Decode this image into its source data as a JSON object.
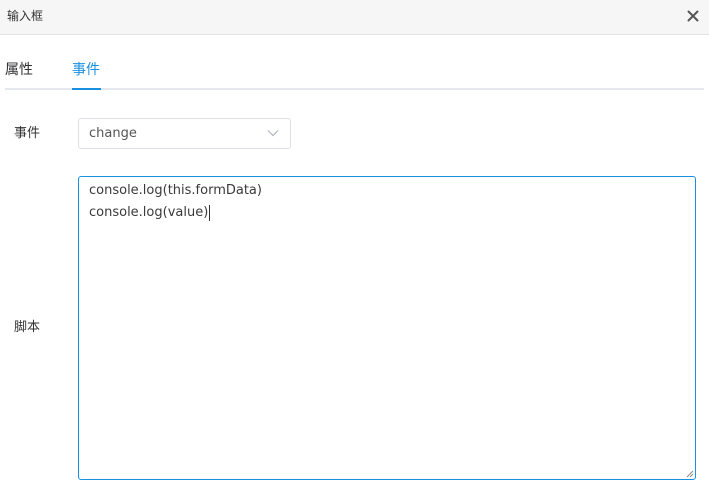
{
  "dialog": {
    "title": "输入框",
    "close_icon": "close-icon"
  },
  "tabs": [
    {
      "label": "属性",
      "active": false
    },
    {
      "label": "事件",
      "active": true
    }
  ],
  "form": {
    "event_label": "事件",
    "event_value": "change",
    "select_icon": "chevron-down-icon",
    "script_label": "脚本",
    "script_lines": [
      "console.log(this.formData)",
      "console.log(value)"
    ]
  },
  "colors": {
    "accent": "#1a90e0",
    "header_bg": "#f6f6f6",
    "border": "#dcdfe6"
  }
}
